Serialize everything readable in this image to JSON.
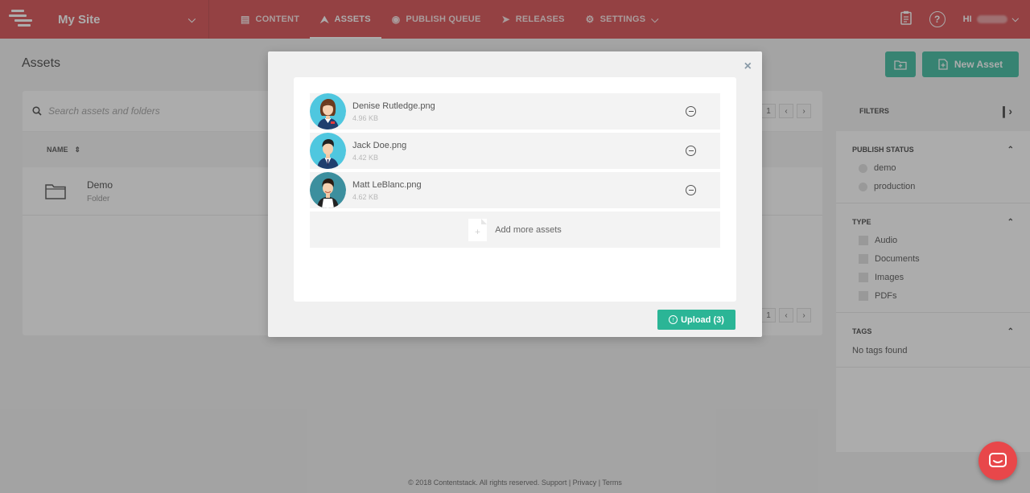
{
  "header": {
    "site_name": "My Site",
    "nav": [
      {
        "label": "CONTENT",
        "icon": "document-icon"
      },
      {
        "label": "ASSETS",
        "icon": "upload-icon",
        "active": true
      },
      {
        "label": "PUBLISH QUEUE",
        "icon": "globe-icon"
      },
      {
        "label": "RELEASES",
        "icon": "rocket-icon"
      },
      {
        "label": "SETTINGS",
        "icon": "gear-icon"
      }
    ],
    "greeting": "HI",
    "help_glyph": "?"
  },
  "page": {
    "title": "Assets",
    "new_asset_label": "New Asset",
    "search_placeholder": "Search assets and folders",
    "page_number": "1",
    "col_name": "NAME",
    "folder": {
      "name": "Demo",
      "type": "Folder"
    }
  },
  "filters": {
    "title": "FILTERS",
    "publish_status": {
      "title": "PUBLISH STATUS",
      "options": [
        "demo",
        "production"
      ]
    },
    "type": {
      "title": "TYPE",
      "options": [
        "Audio",
        "Documents",
        "Images",
        "PDFs"
      ]
    },
    "tags": {
      "title": "TAGS",
      "empty": "No tags found"
    }
  },
  "modal": {
    "close_glyph": "×",
    "files": [
      {
        "name": "Denise Rutledge.png",
        "size": "4.96 KB"
      },
      {
        "name": "Jack Doe.png",
        "size": "4.42 KB"
      },
      {
        "name": "Matt LeBlanc.png",
        "size": "4.62 KB"
      }
    ],
    "add_more_label": "Add more assets",
    "upload_label": "Upload (3)"
  },
  "footer": {
    "text": "© 2018 Contentstack. All rights reserved. Support | Privacy | Terms"
  },
  "colors": {
    "brand": "#d33c40",
    "accent": "#2bb596"
  }
}
